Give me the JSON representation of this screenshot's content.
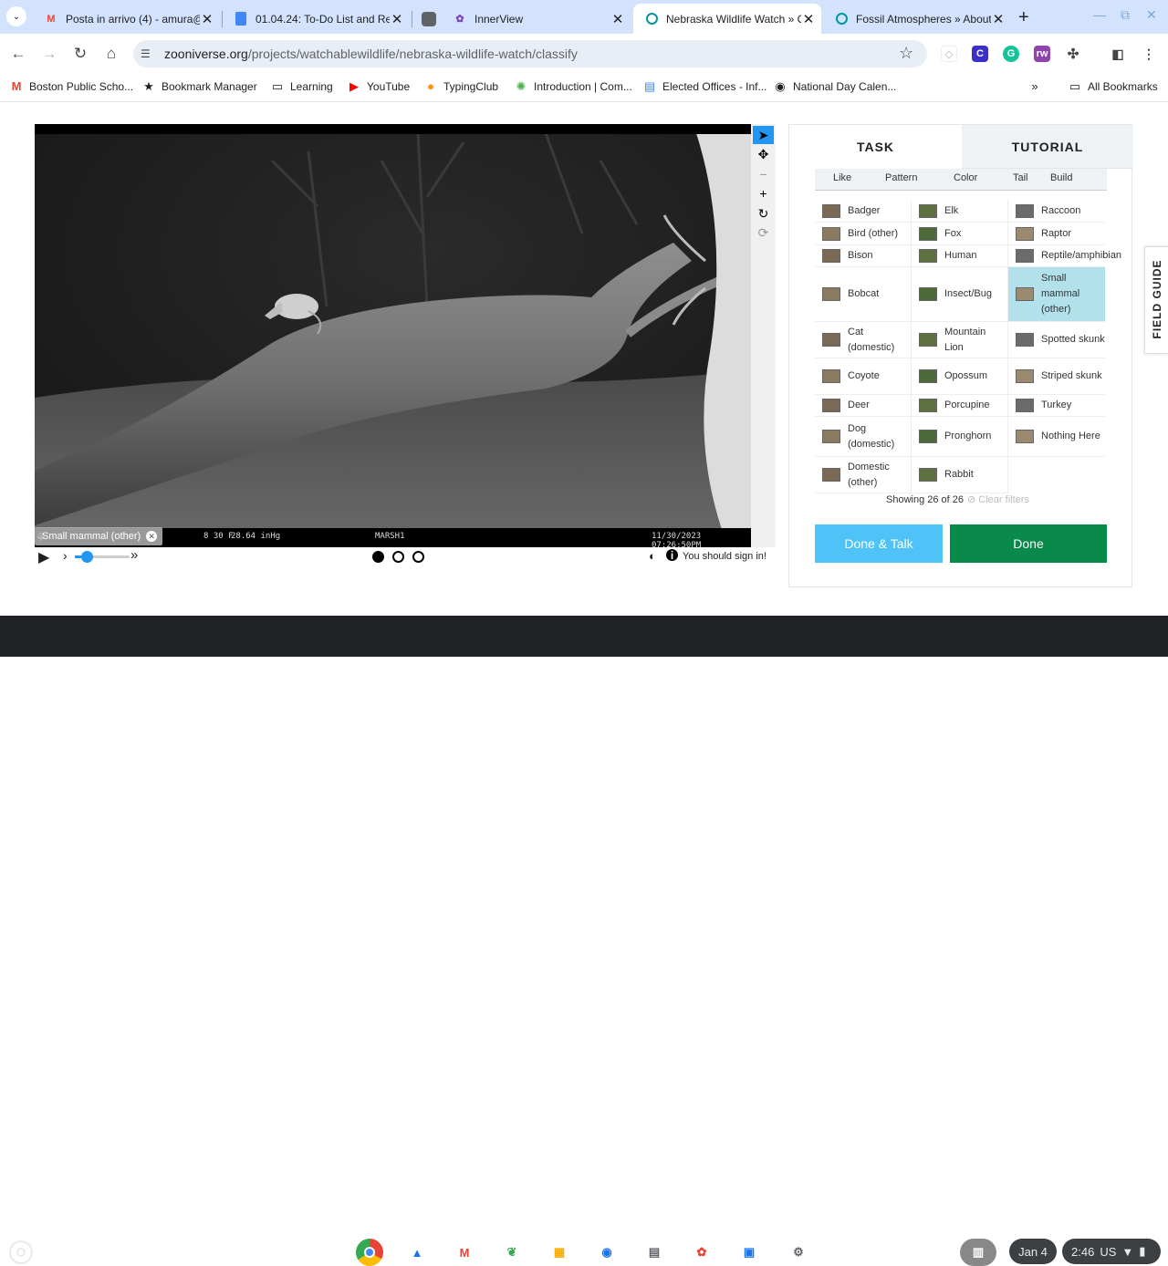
{
  "browser": {
    "tabs": [
      {
        "title": "Posta in arrivo (4) - amura@",
        "icon": "gmail-icon"
      },
      {
        "title": "01.04.24: To-Do List and Re",
        "icon": "docs-icon"
      },
      {
        "title": "",
        "icon": "app-icon"
      },
      {
        "title": "InnerView",
        "icon": "innerview-icon"
      },
      {
        "title": "Nebraska Wildlife Watch » C",
        "icon": "zooniverse-icon",
        "active": true
      },
      {
        "title": "Fossil Atmospheres » About",
        "icon": "zooniverse-icon"
      }
    ],
    "url_host": "zooniverse.org",
    "url_path": "/projects/watchablewildlife/nebraska-wildlife-watch/classify",
    "bookmarks": [
      "Boston Public Scho...",
      "Bookmark Manager",
      "Learning",
      "YouTube",
      "TypingClub",
      "Introduction | Com...",
      "Elected Offices - Inf...",
      "National Day Calen..."
    ],
    "all_bookmarks": "All Bookmarks"
  },
  "viewer": {
    "overlay_temp": "8 30 F",
    "overlay_pressure": "28.64 inHg",
    "overlay_location": "MARSH1",
    "overlay_timestamp": "11/30/2023  07:26:50PM",
    "selected_chip": "Small mammal (other)",
    "sign_in": "You should sign in!"
  },
  "panel": {
    "tab_task": "TASK",
    "tab_tutorial": "TUTORIAL",
    "filters": [
      "Like",
      "Pattern",
      "Color",
      "Tail",
      "Build"
    ],
    "species": [
      [
        "Badger",
        "Elk",
        "Raccoon"
      ],
      [
        "Bird (other)",
        "Fox",
        "Raptor"
      ],
      [
        "Bison",
        "Human",
        "Reptile/amphibian"
      ],
      [
        "Bobcat",
        "Insect/Bug",
        "Small mammal (other)"
      ],
      [
        "Cat (domestic)",
        "Mountain Lion",
        "Spotted skunk"
      ],
      [
        "Coyote",
        "Opossum",
        "Striped skunk"
      ],
      [
        "Deer",
        "Porcupine",
        "Turkey"
      ],
      [
        "Dog (domestic)",
        "Pronghorn",
        "Nothing Here"
      ],
      [
        "Domestic (other)",
        "Rabbit",
        ""
      ]
    ],
    "showing": "Showing 26 of 26",
    "clear_filters": "Clear filters",
    "done_talk": "Done & Talk",
    "done": "Done",
    "field_guide": "FIELD GUIDE",
    "colors": {
      "done_talk": "#4fc3f7",
      "done": "#0a8a4a",
      "selected": "#b2e1ec"
    }
  },
  "shelf": {
    "date": "Jan 4",
    "time": "2:46",
    "locale": "US"
  }
}
